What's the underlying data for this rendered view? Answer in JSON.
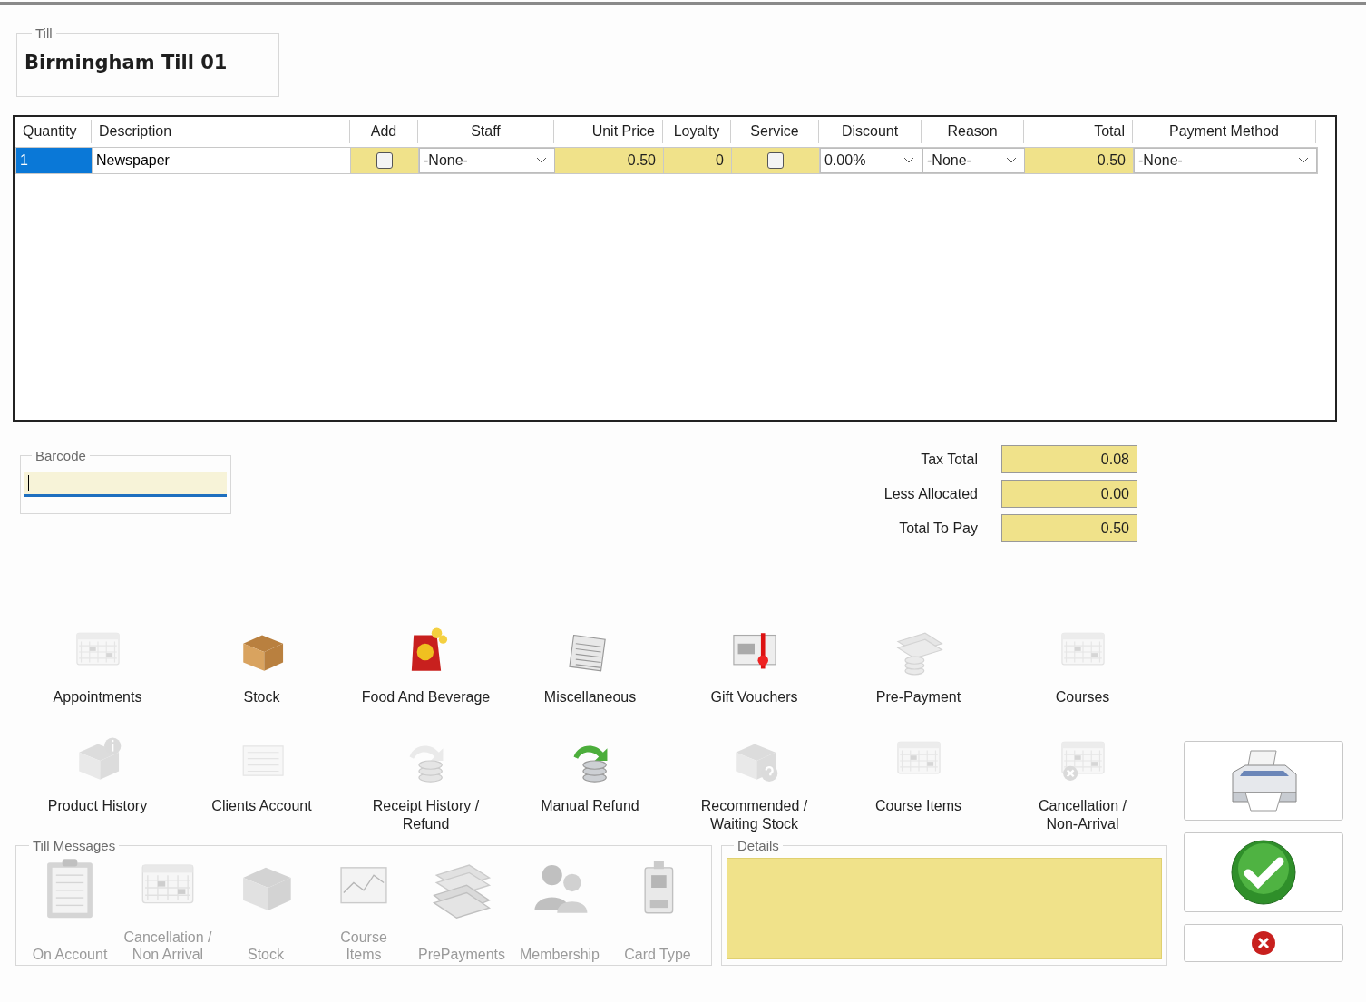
{
  "till": {
    "legend": "Till",
    "name": "Birmingham Till 01"
  },
  "grid": {
    "columns": [
      "Quantity",
      "Description",
      "Add",
      "Staff",
      "Unit Price",
      "Loyalty",
      "Service",
      "Discount",
      "Reason",
      "Total",
      "Payment Method"
    ],
    "rows": [
      {
        "selected": true,
        "cells": [
          {
            "kind": "text",
            "value": "1"
          },
          {
            "kind": "text",
            "value": "Newspaper"
          },
          {
            "kind": "check",
            "checked": false
          },
          {
            "kind": "combo",
            "value": "-None-"
          },
          {
            "kind": "number",
            "value": "0.50"
          },
          {
            "kind": "number",
            "value": "0"
          },
          {
            "kind": "check",
            "checked": false
          },
          {
            "kind": "combo",
            "value": "0.00%"
          },
          {
            "kind": "combo",
            "value": "-None-"
          },
          {
            "kind": "number",
            "value": "0.50"
          },
          {
            "kind": "combo",
            "value": "-None-"
          }
        ]
      }
    ]
  },
  "barcode": {
    "legend": "Barcode",
    "focused": true
  },
  "totals": [
    {
      "label": "Tax Total",
      "value": "0.08"
    },
    {
      "label": "Less Allocated",
      "value": "0.00"
    },
    {
      "label": "Total To Pay",
      "value": "0.50"
    }
  ],
  "tiles": [
    {
      "label": "Appointments",
      "disabled": true
    },
    {
      "label": "Stock",
      "disabled": false
    },
    {
      "label": "Food And Beverage",
      "disabled": false
    },
    {
      "label": "Miscellaneous",
      "disabled": false
    },
    {
      "label": "Gift Vouchers",
      "disabled": false
    },
    {
      "label": "Pre-Payment",
      "disabled": true
    },
    {
      "label": "Courses",
      "disabled": true
    },
    {
      "label": "Product History",
      "disabled": true
    },
    {
      "label": "Clients Account",
      "disabled": true
    },
    {
      "label": "Receipt History /\nRefund",
      "disabled": true
    },
    {
      "label": "Manual Refund",
      "disabled": false
    },
    {
      "label": "Recommended /\nWaiting Stock",
      "disabled": true
    },
    {
      "label": "Course Items",
      "disabled": true
    },
    {
      "label": "Cancellation /\nNon-Arrival",
      "disabled": true
    }
  ],
  "till_messages": {
    "legend": "Till Messages",
    "items": [
      {
        "label": "On Account",
        "disabled": true
      },
      {
        "label": "Cancellation /\nNon Arrival",
        "disabled": true
      },
      {
        "label": "Stock",
        "disabled": true
      },
      {
        "label": "Course\nItems",
        "disabled": true
      },
      {
        "label": "PrePayments",
        "disabled": true
      },
      {
        "label": "Membership",
        "disabled": true
      },
      {
        "label": "Card Type",
        "disabled": true
      }
    ]
  },
  "details": {
    "legend": "Details"
  }
}
